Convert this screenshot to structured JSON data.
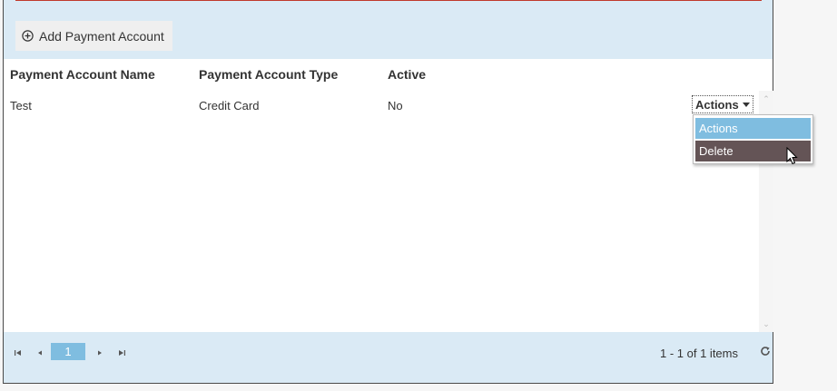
{
  "toolbar": {
    "add_label": "Add Payment Account"
  },
  "grid": {
    "headers": [
      "Payment Account Name",
      "Payment Account Type",
      "Active"
    ],
    "rows": [
      {
        "name": "Test",
        "type": "Credit Card",
        "active": "No",
        "actions_label": "Actions"
      }
    ]
  },
  "dropdown": {
    "items": [
      "Actions",
      "Delete"
    ]
  },
  "pager": {
    "current_page": "1",
    "items_info": "1 - 1 of 1 items"
  },
  "icons": [
    "plus-circle-icon",
    "caret-down-icon",
    "first-page-icon",
    "prev-page-icon",
    "next-page-icon",
    "last-page-icon",
    "refresh-icon",
    "mouse-cursor-icon"
  ],
  "colors": {
    "toolbar_bg": "#daeaf5",
    "accent": "#7fbde0",
    "selected": "#645456",
    "top_line": "#c0392b"
  }
}
